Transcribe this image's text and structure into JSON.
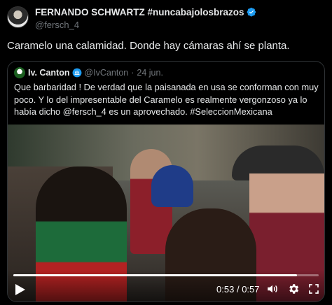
{
  "post": {
    "author_name": "FERNANDO SCHWARTZ #nuncabajolosbrazos",
    "handle": "@fersch_4",
    "text": "Caramelo una calamidad. Donde hay cámaras ahí se planta."
  },
  "quote": {
    "author_name": "Iv. Canton",
    "handle": "@IvCanton",
    "separator": "·",
    "date": "24 jun.",
    "body": "Que barbaridad ! De verdad que la paisanada en usa se conforman con muy\npoco. Y lo del impresentable del Caramelo es realmente vergonzoso  ya lo\nhabía dicho @fersch_4 es un aprovechado. #SeleccionMexicana"
  },
  "video": {
    "current_time": "0:53",
    "time_sep": "/",
    "duration": "0:57",
    "progress": 0.93,
    "icons": [
      "play-icon",
      "volume-icon",
      "settings-icon",
      "fullscreen-icon"
    ]
  },
  "colors": {
    "background": "#000000",
    "text": "#e7e9ea",
    "muted": "#71767b",
    "verified": "#1d9bf0",
    "border": "#2f3336"
  }
}
